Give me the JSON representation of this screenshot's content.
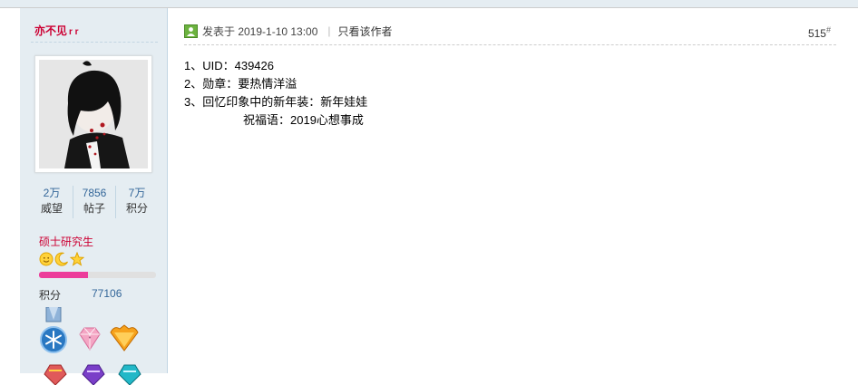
{
  "user": {
    "name": "亦不见",
    "name_suffix": "r r",
    "stats": [
      {
        "value": "2万",
        "label": "威望"
      },
      {
        "value": "7856",
        "label": "帖子"
      },
      {
        "value": "7万",
        "label": "积分"
      }
    ],
    "rank_title": "硕士研究生",
    "rank_icons": [
      "sun-icon",
      "moon-icon",
      "star-icon"
    ],
    "rank_progress_percent": 42,
    "credit_label": "积分",
    "credit_value": "77106",
    "medals": [
      "snowflake-medal-icon",
      "pink-gem-medal-icon",
      "orange-gem-medal-icon",
      "red-medal-icon",
      "purple-medal-icon",
      "teal-medal-icon"
    ]
  },
  "post": {
    "posted_at": "发表于 2019-1-10 13:00",
    "author_only": "只看该作者",
    "floor": "515",
    "floor_mark": "#",
    "lines": [
      "1、UID：439426",
      "2、勋章：要热情洋溢",
      "3、回忆印象中的新年装：新年娃娃",
      "                  祝福语：2019心想事成"
    ]
  },
  "colors": {
    "sidebar_bg": "#e5edf2",
    "username": "#cc0033",
    "link_blue": "#336699",
    "progress": "#ec3c9a"
  }
}
